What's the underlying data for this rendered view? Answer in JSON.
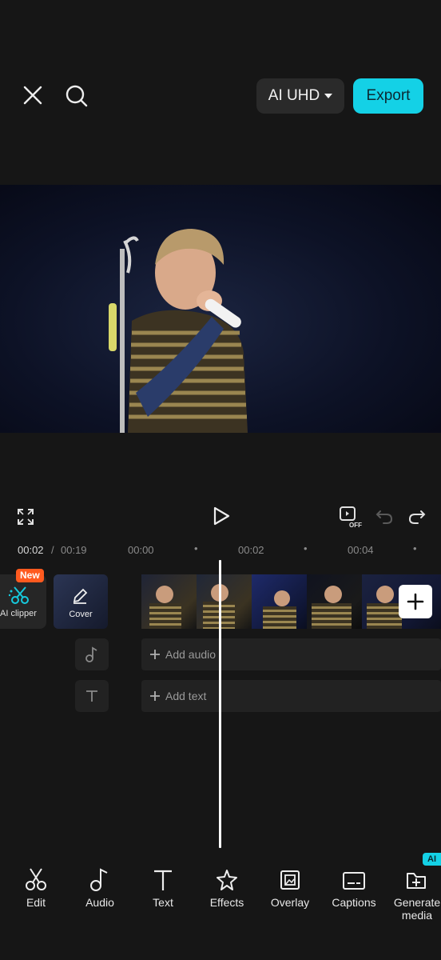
{
  "topbar": {
    "close_icon": "close-icon",
    "search_icon": "search-icon",
    "quality_label": "AI UHD",
    "export_label": "Export"
  },
  "playback": {
    "current_time": "00:02",
    "separator": "/",
    "total_time": "00:19",
    "ruler_ticks": [
      "00:00",
      "00:02",
      "00:04"
    ]
  },
  "tracks": {
    "ai_clipper_badge": "New",
    "ai_clipper_label": "AI clipper",
    "cover_label": "Cover",
    "add_audio_label": "Add audio",
    "add_text_label": "Add text"
  },
  "toolbar": {
    "items": [
      {
        "label": "Edit",
        "icon": "scissors-icon"
      },
      {
        "label": "Audio",
        "icon": "music-note-icon"
      },
      {
        "label": "Text",
        "icon": "text-icon"
      },
      {
        "label": "Effects",
        "icon": "sparkle-star-icon"
      },
      {
        "label": "Overlay",
        "icon": "overlay-icon"
      },
      {
        "label": "Captions",
        "icon": "captions-icon"
      },
      {
        "label": "Generate media",
        "icon": "generate-media-icon"
      }
    ],
    "generate_badge": "AI"
  },
  "colors": {
    "accent": "#14d1e6",
    "badge_new": "#ff5a1f",
    "background": "#161616"
  }
}
